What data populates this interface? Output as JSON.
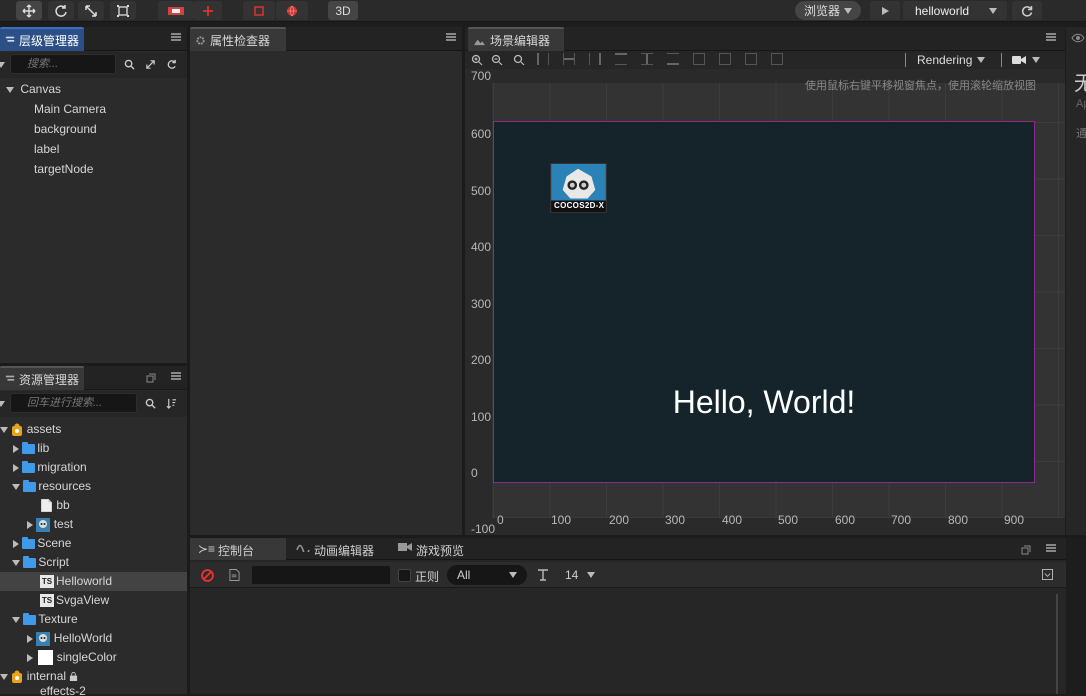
{
  "toolbar": {
    "mode_3d": "3D",
    "browser_label": "浏览器",
    "scene_select": "helloworld"
  },
  "hierarchy": {
    "tab": "层级管理器",
    "search_placeholder": "搜索...",
    "root": "Canvas",
    "children": [
      "Main Camera",
      "background",
      "label",
      "targetNode"
    ]
  },
  "inspector": {
    "tab": "属性检查器"
  },
  "assets": {
    "tab": "资源管理器",
    "search_placeholder": "回车进行搜索...",
    "items": [
      "assets",
      "lib",
      "migration",
      "resources",
      "bb",
      "test",
      "Scene",
      "Script",
      "Helloworld",
      "SvgaView",
      "Texture",
      "HelloWorld",
      "singleColor",
      "internal",
      "effects-2"
    ]
  },
  "scene": {
    "tab": "场景编辑器",
    "rendering": "Rendering",
    "hint": "使用鼠标右键平移视窗焦点，使用滚轮缩放视图",
    "hello_text": "Hello, World!",
    "logo_text": "COCOS2D-X",
    "y_ticks": [
      "700",
      "600",
      "500",
      "400",
      "300",
      "200",
      "100",
      "0",
      "-100"
    ],
    "x_ticks": [
      "0",
      "100",
      "200",
      "300",
      "400",
      "500",
      "600",
      "700",
      "800",
      "900"
    ]
  },
  "console": {
    "tabs": [
      "控制台",
      "动画编辑器",
      "游戏预览"
    ],
    "regex_label": "正则",
    "level": "All",
    "font_size": "14"
  },
  "right_panel": {
    "glyph": "无",
    "line2": "Ap",
    "line3": "通"
  },
  "colors": {
    "accent": "#2c4f86",
    "canvas_border": "#8a2d8a",
    "folder": "#3f9bea",
    "asset_root": "#e8a21c"
  }
}
